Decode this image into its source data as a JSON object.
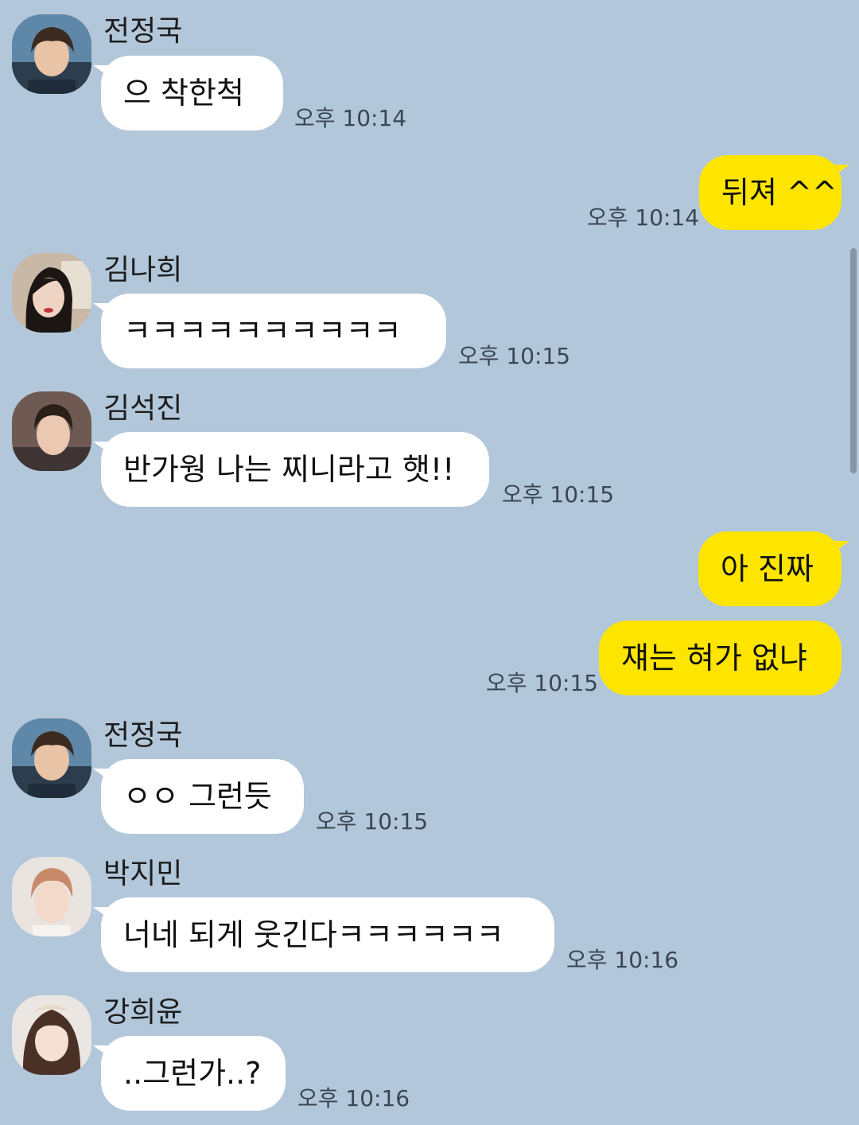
{
  "messages": [
    {
      "side": "in",
      "sender": "전정국",
      "text": "으 착한척",
      "time": "오후 10:14",
      "avatar": "avatar-boy-dark"
    },
    {
      "side": "out",
      "text": "뒤져 ^^",
      "time": "오후 10:14"
    },
    {
      "side": "in",
      "sender": "김나희",
      "text": "ㅋㅋㅋㅋㅋㅋㅋㅋㅋㅋ",
      "time": "오후 10:15",
      "avatar": "avatar-girl-dark"
    },
    {
      "side": "in",
      "sender": "김석진",
      "text": "반가웡 나는 찌니라고 햇!!",
      "time": "오후 10:15",
      "avatar": "avatar-man-dark"
    },
    {
      "side": "out",
      "text": "아 진짜",
      "time": ""
    },
    {
      "side": "out",
      "text": "쟤는 혀가 없냐",
      "time": "오후 10:15"
    },
    {
      "side": "in",
      "sender": "전정국",
      "text": "ㅇㅇ 그런듯",
      "time": "오후 10:15",
      "avatar": "avatar-boy-dark"
    },
    {
      "side": "in",
      "sender": "박지민",
      "text": "너네 되게 웃긴다ㅋㅋㅋㅋㅋㅋ",
      "time": "오후 10:16",
      "avatar": "avatar-boy-light"
    },
    {
      "side": "in",
      "sender": "강희윤",
      "text": "..그런가..?",
      "time": "오후 10:16",
      "avatar": "avatar-girl-light"
    }
  ],
  "colors": {
    "background": "#b2c7da",
    "incoming_bubble": "#ffffff",
    "outgoing_bubble": "#fee500",
    "time_text": "#3a4652"
  }
}
